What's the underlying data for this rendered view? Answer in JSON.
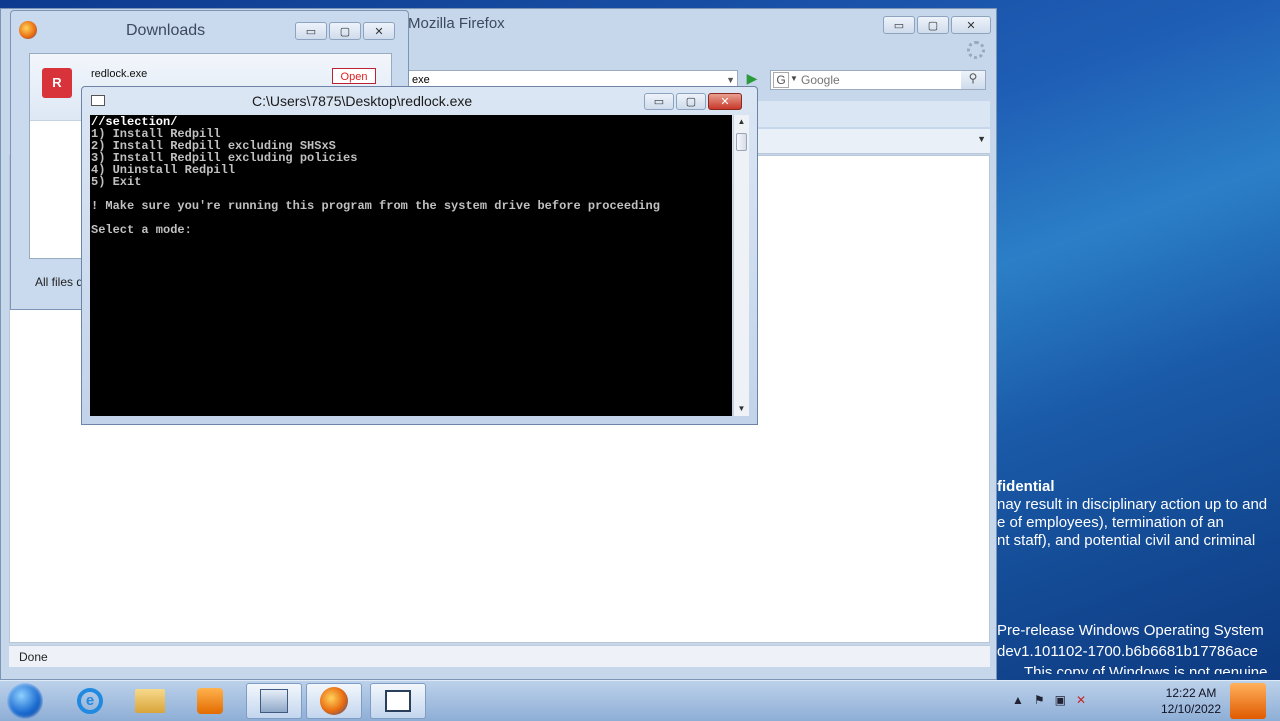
{
  "desktop": {
    "watermark_lines": [
      "fidential",
      "nay result in disciplinary action up to and",
      "e of employees), termination of an",
      "nt staff), and potential civil and criminal"
    ],
    "build_lines": [
      "Pre-release Windows Operating System",
      "dev1.101102-1700.b6b6681b17786ace",
      "This copy of Windows is not genuine"
    ]
  },
  "firefox": {
    "title": "Mozilla Firefox",
    "url_fragment": "exe",
    "search_placeholder": "Google",
    "status": "Done"
  },
  "downloads": {
    "title": "Downloads",
    "item": {
      "filename": "redlock.exe",
      "open_label": "Open",
      "icon_letter": "R"
    },
    "footer": "All files d"
  },
  "console": {
    "title": "C:\\Users\\7875\\Desktop\\redlock.exe",
    "lines": [
      "//selection/",
      "1) Install Redpill",
      "2) Install Redpill excluding SHSxS",
      "3) Install Redpill excluding policies",
      "4) Uninstall Redpill",
      "5) Exit",
      "",
      "! Make sure you're running this program from the system drive before proceeding",
      "",
      "Select a mode:"
    ]
  },
  "window_buttons": {
    "minimize": "▭",
    "maximize": "▢",
    "close": "✕"
  },
  "taskbar": {
    "items": [
      "start",
      "internet-explorer",
      "explorer",
      "media-player",
      "remote-desktop",
      "firefox",
      "console"
    ],
    "tray_arrow": "▲",
    "time": "12:22 AM",
    "date": "12/10/2022"
  },
  "colors": {
    "console_bg": "#000000",
    "console_fg": "#c0c0c0",
    "close_red": "#c8382a"
  }
}
